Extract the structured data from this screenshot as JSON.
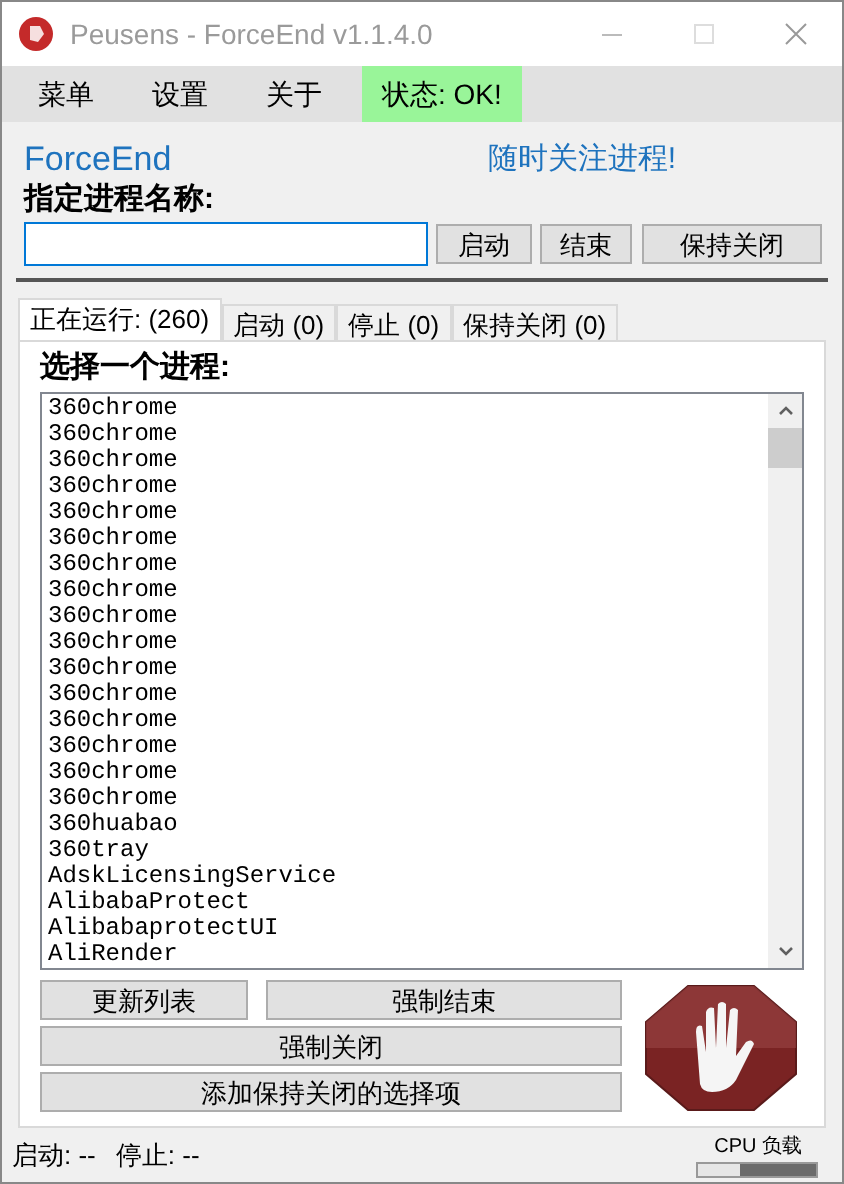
{
  "window": {
    "title": "Peusens - ForceEnd v1.1.4.0"
  },
  "menu": [
    {
      "label": "菜单"
    },
    {
      "label": "设置"
    },
    {
      "label": "关于"
    }
  ],
  "status_chip": "状态: OK!",
  "app_name": "ForceEnd",
  "slogan": "随时关注进程!",
  "name_label": "指定进程名称:",
  "name_buttons": [
    "启动",
    "结束",
    "保持关闭"
  ],
  "tabs": [
    {
      "label": "正在运行: (260)",
      "selected": true
    },
    {
      "label": "启动 (0)",
      "selected": false
    },
    {
      "label": "停止 (0)",
      "selected": false
    },
    {
      "label": "保持关闭 (0)",
      "selected": false
    }
  ],
  "list_label": "选择一个进程:",
  "processes": [
    "360chrome",
    "360chrome",
    "360chrome",
    "360chrome",
    "360chrome",
    "360chrome",
    "360chrome",
    "360chrome",
    "360chrome",
    "360chrome",
    "360chrome",
    "360chrome",
    "360chrome",
    "360chrome",
    "360chrome",
    "360chrome",
    "360huabao",
    "360tray",
    "AdskLicensingService",
    "AlibabaProtect",
    "AlibabaprotectUI",
    "AliRender"
  ],
  "actions": {
    "refresh": "更新列表",
    "force_end": "强制结束",
    "force_close": "强制关闭",
    "add_keep_closed": "添加保持关闭的选择项"
  },
  "status_bar": {
    "started": "启动: --",
    "stopped": "停止: --",
    "cpu_label": "CPU 负载",
    "cpu": {
      "level": 0.35
    }
  }
}
